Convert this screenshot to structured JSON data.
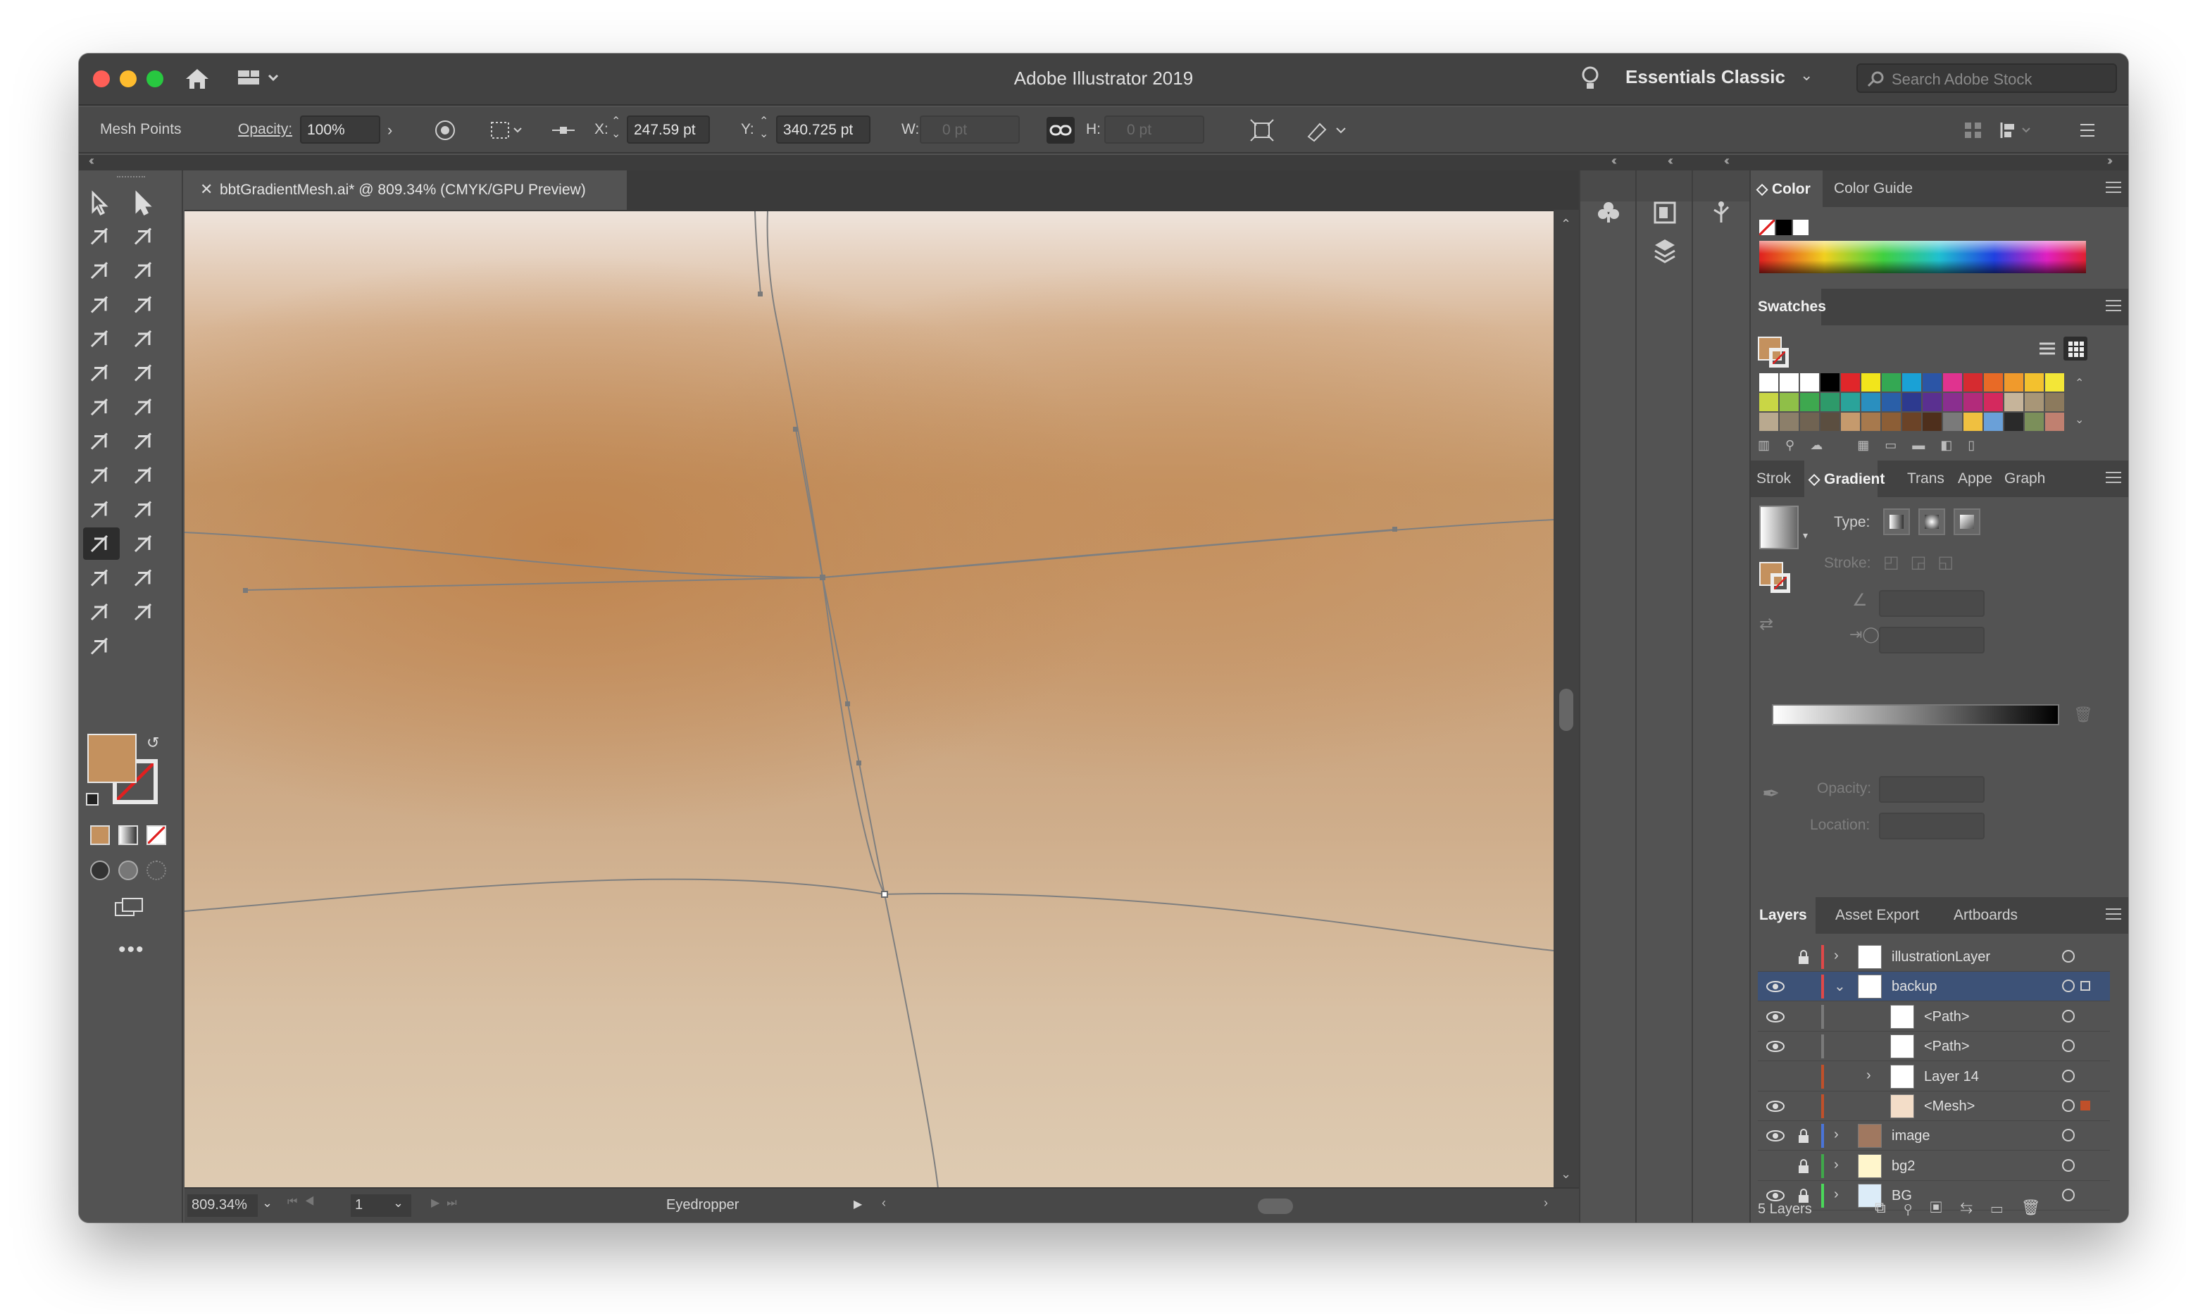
{
  "window": {
    "title": "Adobe Illustrator 2019",
    "workspace": "Essentials Classic",
    "stock_search_placeholder": "Search Adobe Stock"
  },
  "control_bar": {
    "selection_label": "Mesh Points",
    "opacity_label": "Opacity:",
    "opacity_value": "100%",
    "x_label": "X:",
    "x_value": "247.59 pt",
    "y_label": "Y:",
    "y_value": "340.725 pt",
    "w_label": "W:",
    "w_value": "0 pt",
    "h_label": "H:",
    "h_value": "0 pt"
  },
  "document": {
    "tab_title": "bbtGradientMesh.ai* @ 809.34% (CMYK/GPU Preview)",
    "zoom": "809.34%",
    "artboard": "1",
    "current_tool": "Eyedropper"
  },
  "tools": [
    "selection-tool",
    "direct-selection-tool",
    "magic-wand-tool",
    "lasso-tool",
    "pen-tool",
    "curvature-tool",
    "type-tool",
    "line-segment-tool",
    "rectangle-tool",
    "paintbrush-tool",
    "shaper-tool",
    "eraser-tool",
    "rotate-tool",
    "scale-tool",
    "warp-tool",
    "puppet-warp-tool",
    "shape-builder-tool",
    "perspective-grid-tool",
    "mesh-tool",
    "gradient-tool",
    "eyedropper-tool",
    "symbol-sprayer-tool",
    "column-graph-tool",
    "artboard-tool",
    "slice-tool",
    "hand-tool",
    "zoom-tool"
  ],
  "colors": {
    "fill": "#c4915e",
    "accent_selected_row": "#3d5277"
  },
  "color_panel": {
    "tabs": [
      "Color",
      "Color Guide"
    ]
  },
  "swatches_panel": {
    "title": "Swatches",
    "rows": [
      [
        "#ffffff",
        "#ffffff",
        "#ffffff",
        "#000000",
        "#e0262a",
        "#f2e51b",
        "#34a853",
        "#1aa1d6",
        "#2b55a6",
        "#e0338f",
        "#d62b30",
        "#e86a26",
        "#f09a2c",
        "#f3c12e",
        "#f3e637"
      ],
      [
        "#c9d645",
        "#8fbf48",
        "#3ea84f",
        "#2e9a6a",
        "#2aa39a",
        "#2a8fbf",
        "#2a5fa8",
        "#2d3a8f",
        "#5a3090",
        "#8a2f8f",
        "#b22b7b",
        "#d4295e",
        "#c6b49a",
        "#a89677",
        "#8c7a5d"
      ],
      [
        "#b9a98f",
        "#8c7f6a",
        "#706352",
        "#5b4e40",
        "#c59a6d",
        "#a7794d",
        "#8c5e36",
        "#6b4327",
        "#4e2f1c",
        "#7a7a7a",
        "#f0c040",
        "#6aa0d8",
        "#2a2a2a",
        "#7b8f5a",
        "#c08070"
      ]
    ]
  },
  "gradient_panel": {
    "tabs": [
      "Strok",
      "Gradient",
      "Trans",
      "Appe",
      "Graph"
    ],
    "type_label": "Type:",
    "stroke_label": "Stroke:",
    "opacity_label": "Opacity:",
    "location_label": "Location:"
  },
  "layers_panel": {
    "tabs": [
      "Layers",
      "Asset Export",
      "Artboards"
    ],
    "count_label": "5 Layers",
    "rows": [
      {
        "name": "illustrationLayer",
        "eye": false,
        "lock": true,
        "color": "#e04848"
      },
      {
        "name": "backup",
        "eye": true,
        "lock": false,
        "color": "#e04848"
      },
      {
        "name": "<Path>",
        "eye": true,
        "lock": false,
        "color": "#7a7a7a"
      },
      {
        "name": "<Path>",
        "eye": true,
        "lock": false,
        "color": "#7a7a7a"
      },
      {
        "name": "Layer 14",
        "eye": false,
        "lock": false,
        "color": "#c0502a"
      },
      {
        "name": "<Mesh>",
        "eye": true,
        "lock": false,
        "color": "#c0502a"
      },
      {
        "name": "image",
        "eye": true,
        "lock": true,
        "color": "#4a74d8"
      },
      {
        "name": "bg2",
        "eye": false,
        "lock": true,
        "color": "#3fa84a"
      },
      {
        "name": "BG",
        "eye": true,
        "lock": true,
        "color": "#4ad85a"
      }
    ]
  }
}
